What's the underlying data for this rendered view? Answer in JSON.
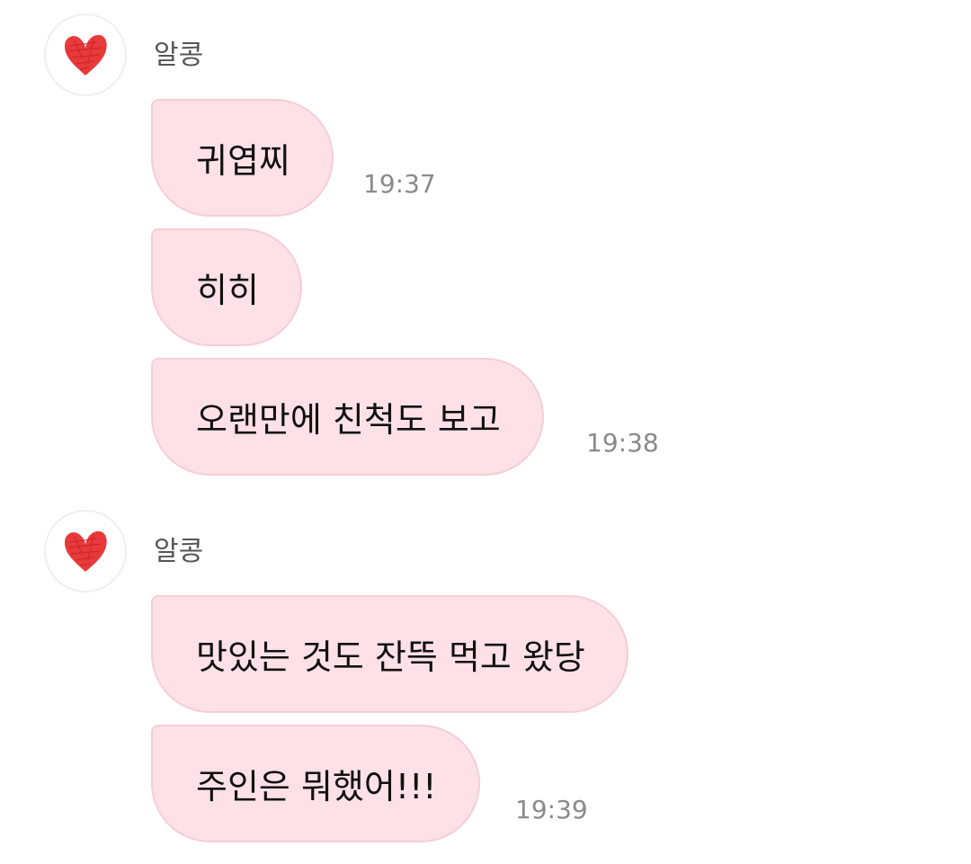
{
  "groups": [
    {
      "sender": {
        "name": "알콩",
        "avatar_icon": "red-heart-icon"
      },
      "messages": [
        {
          "text": "귀엽찌",
          "time": "19:37"
        },
        {
          "text": "히히",
          "time": ""
        },
        {
          "text": "오랜만에 친척도 보고",
          "time": "19:38"
        }
      ]
    },
    {
      "sender": {
        "name": "알콩",
        "avatar_icon": "red-heart-icon"
      },
      "messages": [
        {
          "text": "맛있는 것도 잔뜩 먹고 왔당",
          "time": ""
        },
        {
          "text": "주인은 뭐했어!!!",
          "time": "19:39"
        }
      ]
    }
  ],
  "colors": {
    "bubble_background": "#fde1e6",
    "bubble_border": "#f7cdd5",
    "heart": "#e83a3a",
    "timestamp": "#8a8a8a"
  }
}
